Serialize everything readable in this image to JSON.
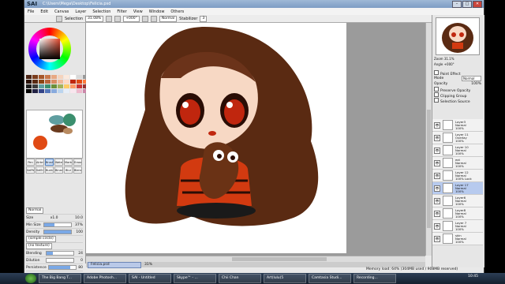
{
  "app": {
    "logo": "SAI",
    "path": "C:\\Users\\Mega\\Desktop\\Felicia.psd"
  },
  "menu": [
    "File",
    "Edit",
    "Canvas",
    "Layer",
    "Selection",
    "Filter",
    "View",
    "Window",
    "Others"
  ],
  "toolbar": {
    "selection_label": "Selection",
    "zoom": "31.08%",
    "angle": "+000°",
    "blend": "Normal",
    "stabilizer_label": "Stabilizer",
    "stabilizer_value": "3"
  },
  "tools": [
    "Pen",
    "Airbrush",
    "Brush",
    "Water",
    "Marker",
    "Eraser",
    "SelPen",
    "SelEras",
    "Bucket",
    "Binary",
    "Blur",
    "Blender"
  ],
  "brush": {
    "mode": "Normal",
    "size_label": "Size",
    "size_mult": "x1.0",
    "size_value": "10.0",
    "min_size_label": "Min Size",
    "min_size_value": "37%",
    "density_label": "Density",
    "density_value": "100",
    "shape": "(simple circle)",
    "texture": "(no texture)",
    "blending_label": "Blending",
    "blending_value": "24",
    "dilution_label": "Dilution",
    "dilution_value": "0",
    "persistence_label": "Persistence",
    "persistence_value": "80"
  },
  "navigator": {
    "zoom_label": "Zoom",
    "zoom_value": "31.1%",
    "angle_label": "Angle",
    "angle_value": "+000°"
  },
  "layer_props": {
    "paint_effect": "Paint Effect",
    "mode_label": "Mode",
    "mode_value": "Normal",
    "opacity_label": "Opacity",
    "opacity_value": "100%",
    "preserve_opacity": "Preserve Opacity",
    "clipping_group": "Clipping Group",
    "selection_source": "Selection Source"
  },
  "layers": [
    {
      "name": "Layer3",
      "mode": "Normal",
      "opacity": "100%"
    },
    {
      "name": "Layer 11",
      "mode": "Overlay",
      "opacity": "100%"
    },
    {
      "name": "Layer 10",
      "mode": "Normal",
      "opacity": "100%"
    },
    {
      "name": "ext",
      "mode": "Normal",
      "opacity": "100%"
    },
    {
      "name": "Layer 12",
      "mode": "Normal",
      "opacity": "100% Lock"
    },
    {
      "name": "Layer 17",
      "mode": "Normal",
      "opacity": "100%"
    },
    {
      "name": "Layer6",
      "mode": "Normal",
      "opacity": "100%"
    },
    {
      "name": "Layer8",
      "mode": "Normal",
      "opacity": "100%"
    },
    {
      "name": "Layer 7",
      "mode": "Normal",
      "opacity": "100%"
    },
    {
      "name": "skin",
      "mode": "Normal",
      "opacity": "100%"
    }
  ],
  "file_tab": {
    "name": "Felicia.psd",
    "zoom": "31%"
  },
  "status": {
    "memory": "Memory load: 64% (304MB used / 908MB reserved)"
  },
  "taskbar": {
    "items": [
      "The Big Bang T...",
      "Adobe Photosh...",
      "SAI - Untitled",
      "Skype™ - ...",
      "Chii Chan",
      "Art(lulu)5",
      "Camtasia Studi...",
      "Recording..."
    ],
    "clock": "10:45"
  },
  "colors": {
    "hair": "#5a2a12",
    "skin": "#f7d8c4",
    "eyes": "#c0260e",
    "shirt": "#d23a10",
    "selected_layer": "#b7caee"
  }
}
